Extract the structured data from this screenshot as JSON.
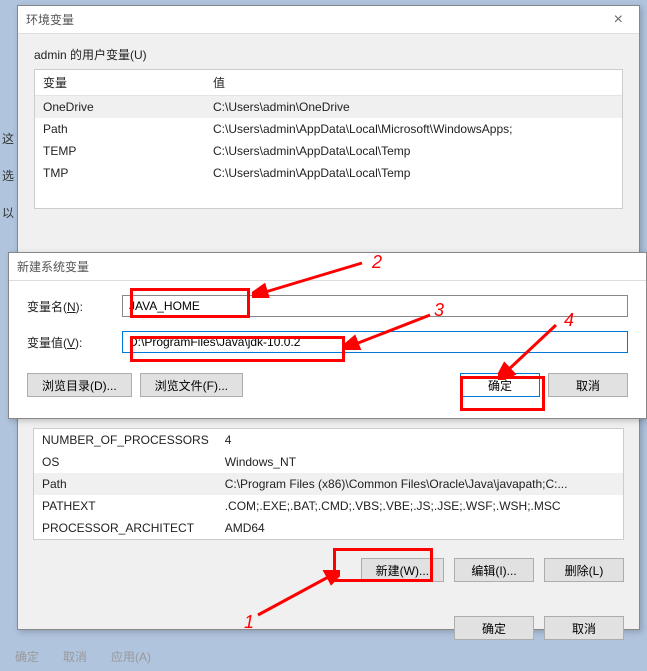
{
  "env_dialog": {
    "title": "环境变量",
    "user_group_label": "admin 的用户变量(U)",
    "col_var": "变量",
    "col_val": "值",
    "user_vars": [
      {
        "name": "OneDrive",
        "value": "C:\\Users\\admin\\OneDrive"
      },
      {
        "name": "Path",
        "value": "C:\\Users\\admin\\AppData\\Local\\Microsoft\\WindowsApps;"
      },
      {
        "name": "TEMP",
        "value": "C:\\Users\\admin\\AppData\\Local\\Temp"
      },
      {
        "name": "TMP",
        "value": "C:\\Users\\admin\\AppData\\Local\\Temp"
      }
    ],
    "sys_vars": [
      {
        "name": "NUMBER_OF_PROCESSORS",
        "value": "4"
      },
      {
        "name": "OS",
        "value": "Windows_NT"
      },
      {
        "name": "Path",
        "value": "C:\\Program Files (x86)\\Common Files\\Oracle\\Java\\javapath;C:..."
      },
      {
        "name": "PATHEXT",
        "value": ".COM;.EXE;.BAT;.CMD;.VBS;.VBE;.JS;.JSE;.WSF;.WSH;.MSC"
      },
      {
        "name": "PROCESSOR_ARCHITECT",
        "value": "AMD64"
      }
    ],
    "btn_new": "新建(W)...",
    "btn_edit": "编辑(I)...",
    "btn_del": "删除(L)",
    "btn_ok": "确定",
    "btn_cancel": "取消"
  },
  "newvar_dialog": {
    "title": "新建系统变量",
    "name_label": "变量名(N):",
    "value_label": "变量值(V):",
    "name_input": "JAVA_HOME",
    "value_input": "D:\\ProgramFiles\\Java\\jdk-10.0.2",
    "btn_browse_dir": "浏览目录(D)...",
    "btn_browse_file": "浏览文件(F)...",
    "btn_ok": "确定",
    "btn_cancel": "取消"
  },
  "side": {
    "a": "这",
    "b": "选",
    "c": "以"
  },
  "bottom": {
    "ok": "确定",
    "cancel": "取消",
    "apply": "应用(A)"
  },
  "ann": {
    "n1": "1",
    "n2": "2",
    "n3": "3",
    "n4": "4"
  }
}
